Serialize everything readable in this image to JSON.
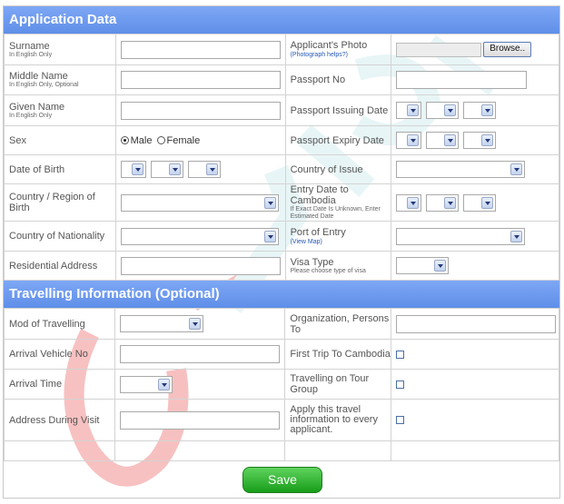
{
  "colors": {
    "header_blue": "#6b9af0",
    "save_green": "#2eae2e",
    "watermark_red": "#e84d4d",
    "watermark_teal": "#bfe4e8"
  },
  "sections": {
    "application": "Application Data",
    "travel": "Travelling Information (Optional)"
  },
  "labels": {
    "surname": "Surname",
    "surname_note": "In English Only",
    "middle_name": "Middle Name",
    "middle_name_note": "In English Only, Optional",
    "given_name": "Given Name",
    "given_name_note": "In English Only",
    "sex": "Sex",
    "dob": "Date of Birth",
    "country_birth": "Country / Region of Birth",
    "country_nationality": "Country of Nationality",
    "residential": "Residential Address",
    "photo": "Applicant's Photo",
    "photo_help": "(Photograph helps?)",
    "passport_no": "Passport No",
    "passport_issue": "Passport Issuing Date",
    "passport_expiry": "Passport Expiry Date",
    "country_issue": "Country of Issue",
    "entry_date": "Entry Date to Cambodia",
    "entry_date_note": "If Exact Date Is Unknown, Enter Estimated Date",
    "port_entry": "Port of Entry",
    "port_entry_link": "(View Map)",
    "visa_type": "Visa Type",
    "visa_type_note": "Please choose type of visa",
    "mod_travel": "Mod of Travelling",
    "arrival_vehicle": "Arrival Vehicle No",
    "arrival_time": "Arrival Time",
    "address_visit": "Address During Visit",
    "org_persons": "Organization, Persons To",
    "first_trip": "First Trip To Cambodia",
    "tour_group": "Travelling on Tour Group",
    "apply_all": "Apply this travel information to every applicant."
  },
  "sex_options": {
    "male": "Male",
    "female": "Female",
    "selected": "Male"
  },
  "buttons": {
    "browse": "Browse..",
    "save": "Save"
  }
}
